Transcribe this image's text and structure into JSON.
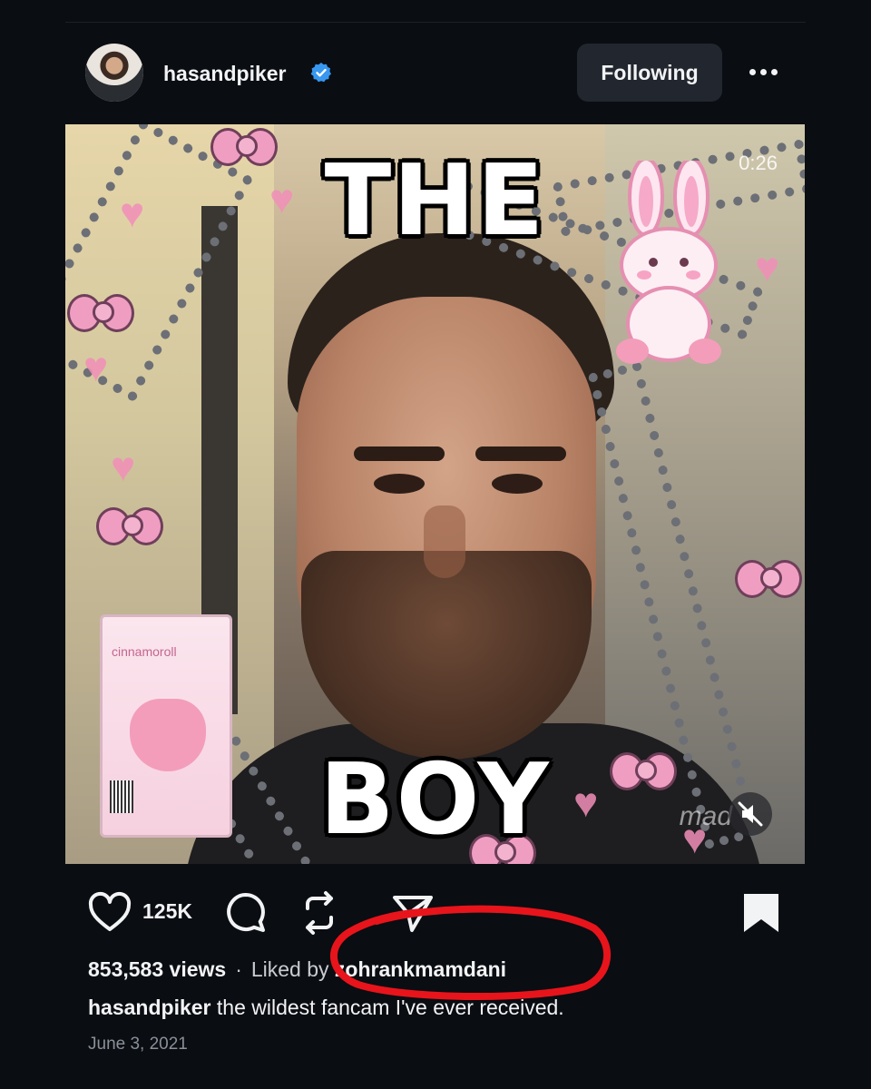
{
  "post": {
    "author": "hasandpiker",
    "follow_label": "Following",
    "more_icon": "more-horizontal-icon",
    "media": {
      "caption_top": "THE",
      "caption_bottom": "BOY",
      "duration": "0:26",
      "watermark": "mad",
      "carton_label": "cinnamoroll"
    },
    "likes": "125K",
    "views": "853,583 views",
    "liked_by_prefix": "Liked by",
    "liked_by_user": "zohrankmamdani",
    "caption_user": "hasandpiker",
    "caption_text": "the wildest fancam I've ever received.",
    "date": "June 3, 2021"
  },
  "colors": {
    "background": "#0a0d12",
    "verified_blue": "#3897f0",
    "annotation_red": "#e8141b",
    "button_bg": "#22262e"
  }
}
